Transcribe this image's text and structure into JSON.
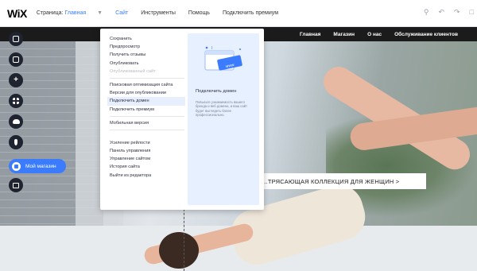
{
  "app": {
    "logo": "WiX"
  },
  "topbar": {
    "page_label": "Страница:",
    "page_value": "Главная",
    "menu": [
      "Сайт",
      "Инструменты",
      "Помощь",
      "Подключить премиум"
    ],
    "active_menu": "Сайт",
    "icons": [
      "zoom-icon",
      "undo-icon",
      "redo-icon",
      "mobile-icon"
    ]
  },
  "site": {
    "nav": [
      "Главная",
      "Магазин",
      "О нас",
      "Обслуживание клиентов"
    ],
    "cta": "...ТРЯСАЮЩАЯ КОЛЛЕКЦИЯ ДЛЯ ЖЕНЩИН >"
  },
  "left_toolbar": {
    "icons": [
      "pages-icon",
      "background-icon",
      "add-icon",
      "apps-icon",
      "upload-icon",
      "blog-icon",
      "store-icon",
      "bookings-icon"
    ],
    "store_label": "Мой магазин"
  },
  "site_menu": {
    "group1": [
      "Сохранить",
      "Предпросмотр",
      "Получить отзывы",
      "Опубликовать"
    ],
    "disabled": "Опубликованный сайт",
    "group2": [
      "Поисковая оптимизация сайта",
      "Версии для опубликовании"
    ],
    "highlighted": "Подключить домен",
    "group3": [
      "Подключить премиум"
    ],
    "group4": [
      "Мобильная версия"
    ],
    "group5": [
      "Усиление рейлости",
      "Панель управления",
      "Управление сайтом",
      "История сайта",
      "Выйти из редактора"
    ]
  },
  "promo": {
    "badge": "www",
    "title": "Подключить домен",
    "text": "Повысьте узнаваемость вашего бренда и веб домена, и ваш сайт будет выглядеть более профессионально."
  },
  "colors": {
    "accent": "#3b7cff",
    "toolbar_dark": "#1f2430",
    "promo_bg": "#e7f0ff"
  }
}
